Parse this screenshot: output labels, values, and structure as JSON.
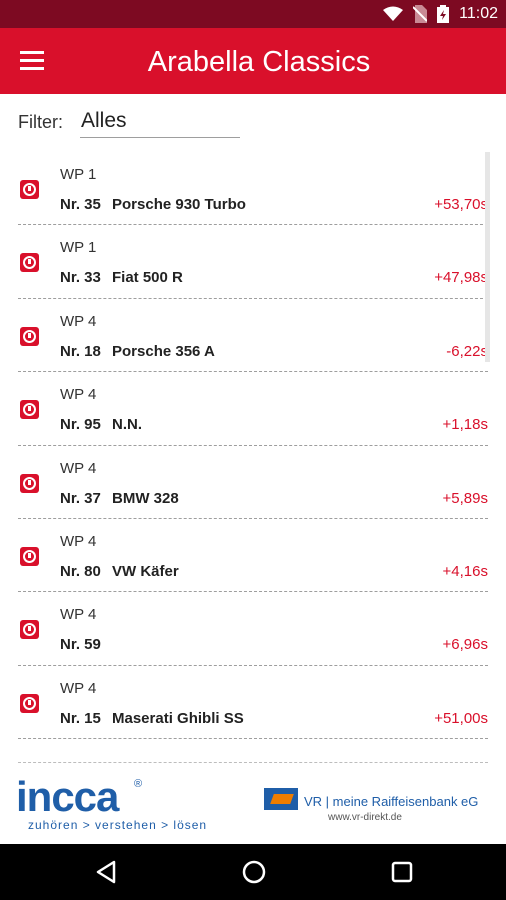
{
  "status_bar": {
    "time": "11:02",
    "icons": [
      "wifi-icon",
      "no-sim-icon",
      "battery-charging-icon"
    ]
  },
  "app_bar": {
    "title": "Arabella Classics",
    "menu_icon": "hamburger-menu-icon"
  },
  "filter": {
    "label": "Filter:",
    "value": "Alles"
  },
  "colors": {
    "accent": "#d9102b",
    "status_bar": "#7d0a22",
    "logo_blue": "#1f5ea8",
    "logo_orange": "#ef7d00"
  },
  "entries": [
    {
      "wp": "WP 1",
      "nr": "Nr. 35",
      "car": "Porsche 930 Turbo",
      "delta": "+53,70s"
    },
    {
      "wp": "WP 1",
      "nr": "Nr. 33",
      "car": "Fiat 500 R",
      "delta": "+47,98s"
    },
    {
      "wp": "WP 4",
      "nr": "Nr. 18",
      "car": "Porsche 356 A",
      "delta": "-6,22s"
    },
    {
      "wp": "WP 4",
      "nr": "Nr. 95",
      "car": "N.N.",
      "delta": "+1,18s"
    },
    {
      "wp": "WP 4",
      "nr": "Nr. 37",
      "car": "BMW 328",
      "delta": "+5,89s"
    },
    {
      "wp": "WP 4",
      "nr": "Nr. 80",
      "car": "VW Käfer",
      "delta": "+4,16s"
    },
    {
      "wp": "WP 4",
      "nr": "Nr. 59",
      "car": "",
      "delta": "+6,96s"
    },
    {
      "wp": "WP 4",
      "nr": "Nr. 15",
      "car": "Maserati Ghibli SS",
      "delta": "+51,00s"
    }
  ],
  "footer": {
    "incca_logo": "incca",
    "incca_reg": "®",
    "incca_tagline": "zuhören > verstehen > lösen",
    "bank_name": "VR | meine Raiffeisenbank eG",
    "bank_url": "www.vr-direkt.de"
  },
  "nav": {
    "back_icon": "back-icon",
    "home_icon": "home-icon",
    "recents_icon": "recents-icon"
  }
}
